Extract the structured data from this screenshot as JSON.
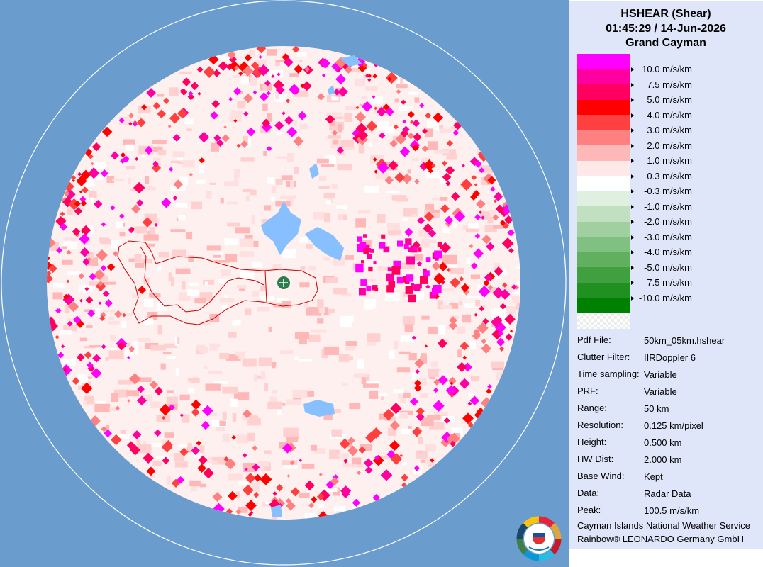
{
  "header": {
    "product": "HSHEAR (Shear)",
    "datetime": "01:45:29 / 14-Jun-2026",
    "site": "Grand Cayman"
  },
  "legend": [
    {
      "label": "10.0 m/s/km",
      "color": "#ff00ff"
    },
    {
      "label": "7.5 m/s/km",
      "color": "#ff00a0"
    },
    {
      "label": "5.0 m/s/km",
      "color": "#ff0060"
    },
    {
      "label": "4.0 m/s/km",
      "color": "#ff0000"
    },
    {
      "label": "3.0 m/s/km",
      "color": "#ff4040"
    },
    {
      "label": "2.0 m/s/km",
      "color": "#ff8080"
    },
    {
      "label": "1.0 m/s/km",
      "color": "#ffb8b8"
    },
    {
      "label": "0.3 m/s/km",
      "color": "#ffe8e8"
    },
    {
      "label": "-0.3 m/s/km",
      "color": "#ffffff"
    },
    {
      "label": "-1.0 m/s/km",
      "color": "#e0f0e0"
    },
    {
      "label": "-2.0 m/s/km",
      "color": "#c0e0c0"
    },
    {
      "label": "-3.0 m/s/km",
      "color": "#a0d0a0"
    },
    {
      "label": "-4.0 m/s/km",
      "color": "#80c080"
    },
    {
      "label": "-5.0 m/s/km",
      "color": "#60b060"
    },
    {
      "label": "-7.5 m/s/km",
      "color": "#40a040"
    },
    {
      "label": "-10.0 m/s/km",
      "color": "#209020"
    }
  ],
  "legend_bottom_color": "#008000",
  "info": [
    {
      "key": "Pdf File:",
      "value": "50km_05km.hshear"
    },
    {
      "key": "Clutter Filter:",
      "value": "IIRDoppler 6"
    },
    {
      "key": "Time sampling:",
      "value": "Variable"
    },
    {
      "key": "PRF:",
      "value": "Variable"
    },
    {
      "key": "Range:",
      "value": "50 km"
    },
    {
      "key": "Resolution:",
      "value": "0.125 km/pixel"
    },
    {
      "key": "Height:",
      "value": "0.500 km"
    },
    {
      "key": "HW Dist:",
      "value": "2.000 km"
    },
    {
      "key": "Base Wind:",
      "value": "Kept"
    },
    {
      "key": "Data:",
      "value": "Radar Data"
    },
    {
      "key": "Peak:",
      "value": "100.5 m/s/km"
    }
  ],
  "footer": {
    "line1": "Cayman Islands National Weather Service",
    "line2": "Rainbow® LEONARDO Germany GmbH"
  },
  "colors": {
    "background": "#6a9ccd",
    "panel": "#dfe6fa",
    "water": "#88c0ff",
    "coastline": "#cc0000",
    "radar_site": "#2e7d4f"
  },
  "icons": {
    "radar_site": "radar-site-icon",
    "logo": "weather-service-logo"
  }
}
